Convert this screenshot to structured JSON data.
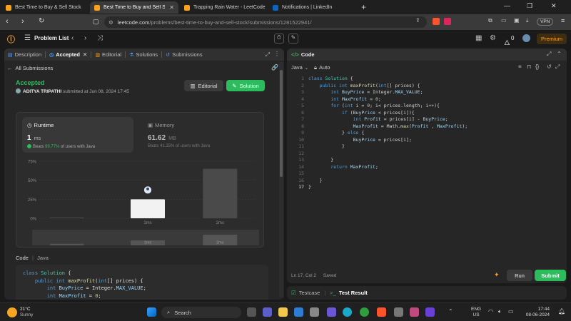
{
  "browser": {
    "tabs": [
      {
        "title": "Best Time to Buy & Sell Stock",
        "active": false
      },
      {
        "title": "Best Time to Buy and Sell Stock",
        "active": true
      },
      {
        "title": "Trapping Rain Water - LeetCode",
        "active": false
      },
      {
        "title": "Notifications | LinkedIn",
        "active": false
      }
    ],
    "url_host": "leetcode.com",
    "url_path": "/problems/best-time-to-buy-and-sell-stock/submissions/1281522941/",
    "vpn_label": "VPN"
  },
  "lc_header": {
    "problem_list": "Problem List",
    "fire_count": "0",
    "premium": "Premium"
  },
  "left": {
    "tabs": [
      {
        "label": "Description",
        "icon": "document-icon"
      },
      {
        "label": "Accepted",
        "icon": "clock-icon",
        "active": true
      },
      {
        "label": "Editorial",
        "icon": "book-icon"
      },
      {
        "label": "Solutions",
        "icon": "flask-icon"
      },
      {
        "label": "Submissions",
        "icon": "history-icon"
      }
    ],
    "all_submissions": "All Submissions",
    "status": "Accepted",
    "user": "ADITYA TRIPATHI",
    "submitted": "submitted at Jun 08, 2024 17:45",
    "editorial_btn": "Editorial",
    "solution_btn": "Solution",
    "runtime": {
      "label": "Runtime",
      "value": "1",
      "unit": "ms",
      "beats_prefix": "Beats",
      "beats_pct": "99.77%",
      "beats_suffix": "of users with Java"
    },
    "memory": {
      "label": "Memory",
      "value": "61.62",
      "unit": "MB",
      "beats_text": "Beats 41.25% of users with Java"
    },
    "code_label": "Code",
    "code_lang": "Java",
    "code_preview": [
      "class Solution {",
      "    public int maxProfit(int[] prices) {",
      "        int BuyPrice = Integer.MAX_VALUE;",
      "        int MaxProfit = 0;",
      "        for (int i = 0; i< prices.length; i++){",
      "            if (BuyPrice < prices[i]){"
    ]
  },
  "chart_data": {
    "type": "bar",
    "y_ticks": [
      "75%",
      "50%",
      "25%",
      "0%"
    ],
    "ylim": [
      0,
      75
    ],
    "categories": [
      "",
      "1ms",
      "2ms"
    ],
    "values": [
      1,
      25,
      65
    ],
    "highlight_index": 1,
    "x_labels": [
      "1ms",
      "2ms"
    ],
    "mini_labels": [
      "1ms",
      "2ms"
    ]
  },
  "right": {
    "title": "Code",
    "lang": "Java",
    "auto": "Auto",
    "status": "Ln 17, Col 2",
    "saved": "Saved",
    "run": "Run",
    "submit": "Submit",
    "testcase": "Testcase",
    "test_result": "Test Result"
  },
  "taskbar": {
    "temp": "21°C",
    "weather": "Sunny",
    "search": "Search",
    "lang1": "ENG",
    "lang2": "US",
    "time": "17:44",
    "date": "08-06-2024"
  }
}
